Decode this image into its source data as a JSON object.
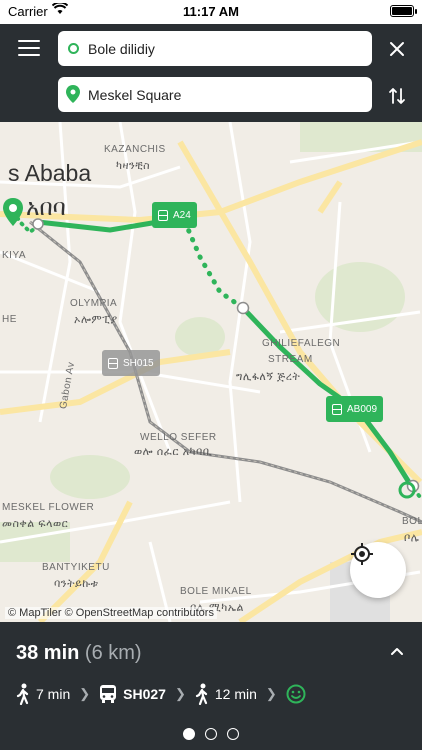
{
  "status": {
    "carrier": "Carrier",
    "time": "11:17 AM"
  },
  "search": {
    "from_value": "Bole dilidiy",
    "to_value": "Meskel Square"
  },
  "map": {
    "labels": {
      "city": "s Ababa",
      "city_amh": "አበባ",
      "kazanchis": "KAZANCHIS",
      "kazanchis_amh": "ካዛንቺስ",
      "kiya": "KIYA",
      "he": "HE",
      "olympia": "OLYMPIA",
      "olympia_amh": "ኦሎምፒያ",
      "ghiliefalegn": "GHILIEFALEGN",
      "stream": "STREAM",
      "ghiliefalegn_amh": "ግሊፋለኝ ጅረት",
      "gabon": "Gabon Av",
      "wello": "WELLO SEFER",
      "wello_amh": "ወሎ ሰፈር አካባቢ",
      "meskel_flower": "MESKEL FLOWER",
      "meskel_flower_amh": "መስቀል ፍላወር",
      "bantyiketu": "BANTYIKETU",
      "bantyiketu_amh": "ባንትይኩቱ",
      "bole_mikael": "BOLE MIKAEL",
      "bole_mikael_amh": "ቦሌ ሚካኤል",
      "bole": "BOL",
      "bole_amh": "ቦሌ"
    },
    "stops": {
      "a24": "A24",
      "sh015": "SH015",
      "ab009": "AB009"
    },
    "attribution": "© MapTiler © OpenStreetMap contributors"
  },
  "trip": {
    "duration": "38 min",
    "distance": "(6 km)",
    "steps": {
      "walk1": "7 min",
      "bus": "SH027",
      "walk2": "12 min"
    }
  },
  "colors": {
    "accent": "#2fb45a",
    "header_bg": "#2a2f33",
    "map_bg": "#f1ede6"
  },
  "pages": {
    "count": 3,
    "active": 1
  }
}
